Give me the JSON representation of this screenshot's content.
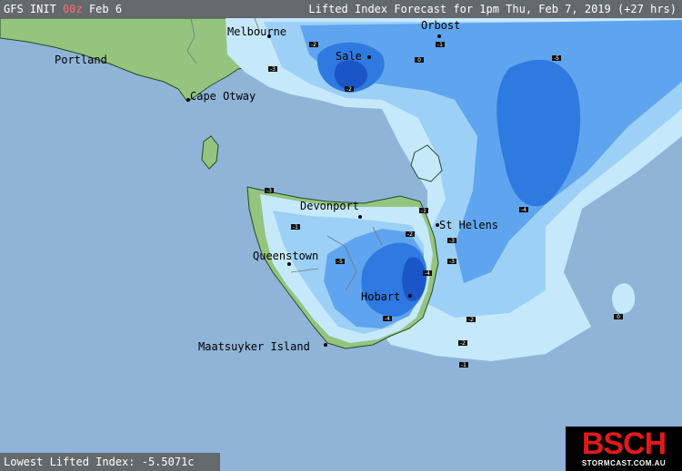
{
  "header": {
    "model": "GFS INIT",
    "run": "00z",
    "date": "Feb 6",
    "title": "Lifted Index Forecast for 1pm Thu, Feb 7, 2019 (+27 hrs)"
  },
  "footer": {
    "lowest_label": "Lowest Lifted Index: -5.5071c"
  },
  "logo": {
    "brand": "BSCH",
    "site": "STORMCAST.COM.AU"
  },
  "places": [
    {
      "name": "Melbourne"
    },
    {
      "name": "Orbost"
    },
    {
      "name": "Portland"
    },
    {
      "name": "Sale"
    },
    {
      "name": "Cape Otway"
    },
    {
      "name": "Devonport"
    },
    {
      "name": "St Helens"
    },
    {
      "name": "Queenstown"
    },
    {
      "name": "Hobart"
    },
    {
      "name": "Maatsuyker Island"
    }
  ],
  "grid_values": [
    "-2",
    "-1",
    "-3",
    "-5",
    "0",
    "-2",
    "-4",
    "-3",
    "-1",
    "-2",
    "-3",
    "-5",
    "-3",
    "-4",
    "-2",
    "-4",
    "-2",
    "-1",
    "0",
    "-1"
  ],
  "colors": {
    "sea": "#8fb4d8",
    "land": "#94c47e",
    "band_0": "#c6e8fb",
    "band_1": "#9dd0f7",
    "band_2": "#5fa4ee",
    "band_3": "#2e7ae0",
    "band_4": "#1a56c8",
    "header_bg": "#5f5f5f",
    "logo_red": "#e01a1a"
  }
}
